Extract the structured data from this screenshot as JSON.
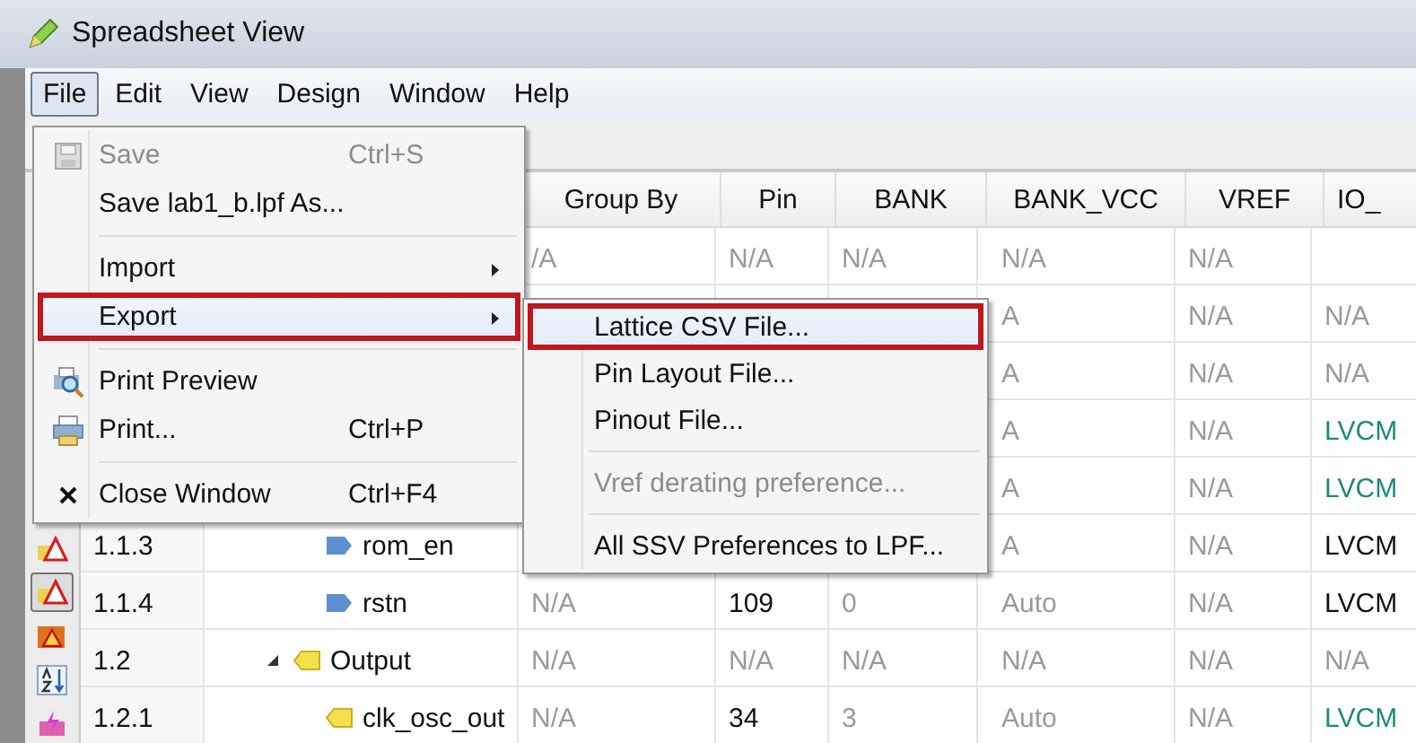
{
  "window": {
    "title": "Spreadsheet View"
  },
  "menu_bar": [
    {
      "label": "File",
      "selected": true
    },
    {
      "label": "Edit",
      "selected": false
    },
    {
      "label": "View",
      "selected": false
    },
    {
      "label": "Design",
      "selected": false
    },
    {
      "label": "Window",
      "selected": false
    },
    {
      "label": "Help",
      "selected": false
    }
  ],
  "file_menu": [
    {
      "kind": "save",
      "label": "Save",
      "shortcut": "Ctrl+S",
      "disabled": true,
      "highlighted": false
    },
    {
      "kind": "plain",
      "label": "Save lab1_b.lpf As...",
      "disabled": false,
      "highlighted": false
    },
    {
      "kind": "separator"
    },
    {
      "kind": "submenu",
      "label": "Import",
      "disabled": false,
      "highlighted": false
    },
    {
      "kind": "submenu",
      "label": "Export",
      "disabled": false,
      "highlighted": true
    },
    {
      "kind": "separator"
    },
    {
      "kind": "preview",
      "label": "Print Preview",
      "disabled": false,
      "highlighted": false
    },
    {
      "kind": "print",
      "label": "Print...",
      "shortcut": "Ctrl+P",
      "disabled": false,
      "highlighted": false
    },
    {
      "kind": "separator"
    },
    {
      "kind": "close",
      "label": "Close Window",
      "shortcut": "Ctrl+F4",
      "disabled": false,
      "highlighted": false
    }
  ],
  "export_submenu": [
    {
      "kind": "item",
      "label": "Lattice CSV File...",
      "disabled": false,
      "highlighted": true
    },
    {
      "kind": "item",
      "label": "Pin Layout File...",
      "disabled": false,
      "highlighted": false
    },
    {
      "kind": "item",
      "label": "Pinout File...",
      "disabled": false,
      "highlighted": false
    },
    {
      "kind": "separator"
    },
    {
      "kind": "item",
      "label": "Vref derating preference...",
      "disabled": true,
      "highlighted": false
    },
    {
      "kind": "separator"
    },
    {
      "kind": "item",
      "label": "All SSV Preferences to LPF...",
      "disabled": false,
      "highlighted": false
    }
  ],
  "side_toolbar": [
    {
      "kind": "warning",
      "selected": false
    },
    {
      "kind": "warning",
      "selected": true
    },
    {
      "kind": "chip-warning",
      "selected": false
    },
    {
      "kind": "sort",
      "selected": false
    },
    {
      "kind": "pink",
      "selected": false
    }
  ],
  "table": {
    "columns": [
      "Group By",
      "Pin",
      "BANK",
      "BANK_VCC",
      "VREF",
      "IO_"
    ],
    "rows": [
      {
        "cells": [
          {
            "text": "/A",
            "kind": "default"
          },
          {
            "text": "N/A",
            "kind": "default"
          },
          {
            "text": "N/A",
            "kind": "default"
          },
          {
            "text": "N/A",
            "kind": "default"
          },
          {
            "text": "N/A",
            "kind": "default"
          },
          null
        ],
        "children": [
          {
            "cells": [
              null,
              null,
              null,
              {
                "text": "A",
                "kind": "default"
              },
              {
                "text": "N/A",
                "kind": "default"
              },
              {
                "text": "N/A",
                "kind": "default"
              }
            ],
            "children": [
              {
                "cells": [
                  null,
                  null,
                  null,
                  {
                    "text": "A",
                    "kind": "default"
                  },
                  {
                    "text": "N/A",
                    "kind": "default"
                  },
                  {
                    "text": "N/A",
                    "kind": "default"
                  }
                ]
              },
              {
                "cells": [
                  null,
                  null,
                  null,
                  {
                    "text": "A",
                    "kind": "default"
                  },
                  {
                    "text": "N/A",
                    "kind": "default"
                  },
                  {
                    "text": "LVCM",
                    "kind": "derived"
                  }
                ]
              },
              {
                "cells": [
                  null,
                  null,
                  null,
                  {
                    "text": "A",
                    "kind": "default"
                  },
                  {
                    "text": "N/A",
                    "kind": "default"
                  },
                  {
                    "text": "LVCM",
                    "kind": "derived"
                  }
                ]
              },
              {
                "number": "1.1.3",
                "name": {
                  "text": "rom_en",
                  "kind": "input"
                },
                "cells": [
                  null,
                  null,
                  null,
                  {
                    "text": "A",
                    "kind": "default"
                  },
                  {
                    "text": "N/A",
                    "kind": "default"
                  },
                  {
                    "text": "LVCM",
                    "kind": "assigned"
                  }
                ]
              },
              {
                "number": "1.1.4",
                "name": {
                  "text": "rstn",
                  "kind": "input"
                },
                "cells": [
                  {
                    "text": "N/A",
                    "kind": "default"
                  },
                  {
                    "text": "109",
                    "kind": "assigned"
                  },
                  {
                    "text": "0",
                    "kind": "default"
                  },
                  {
                    "text": "Auto",
                    "kind": "default"
                  },
                  {
                    "text": "N/A",
                    "kind": "default"
                  },
                  {
                    "text": "LVCM",
                    "kind": "assigned"
                  }
                ]
              }
            ]
          },
          {
            "number": "1.2",
            "name": {
              "text": "Output",
              "kind": "output"
            },
            "expanded": true,
            "cells": [
              {
                "text": "N/A",
                "kind": "default"
              },
              {
                "text": "N/A",
                "kind": "default"
              },
              {
                "text": "N/A",
                "kind": "default"
              },
              {
                "text": "N/A",
                "kind": "default"
              },
              {
                "text": "N/A",
                "kind": "default"
              },
              {
                "text": "N/A",
                "kind": "default"
              }
            ],
            "children": [
              {
                "number": "1.2.1",
                "name": {
                  "text": "clk_osc_out",
                  "kind": "output"
                },
                "cells": [
                  {
                    "text": "N/A",
                    "kind": "default"
                  },
                  {
                    "text": "34",
                    "kind": "assigned"
                  },
                  {
                    "text": "3",
                    "kind": "default"
                  },
                  {
                    "text": "Auto",
                    "kind": "default"
                  },
                  {
                    "text": "N/A",
                    "kind": "default"
                  },
                  {
                    "text": "LVCM",
                    "kind": "derived"
                  }
                ]
              }
            ]
          }
        ]
      }
    ]
  }
}
